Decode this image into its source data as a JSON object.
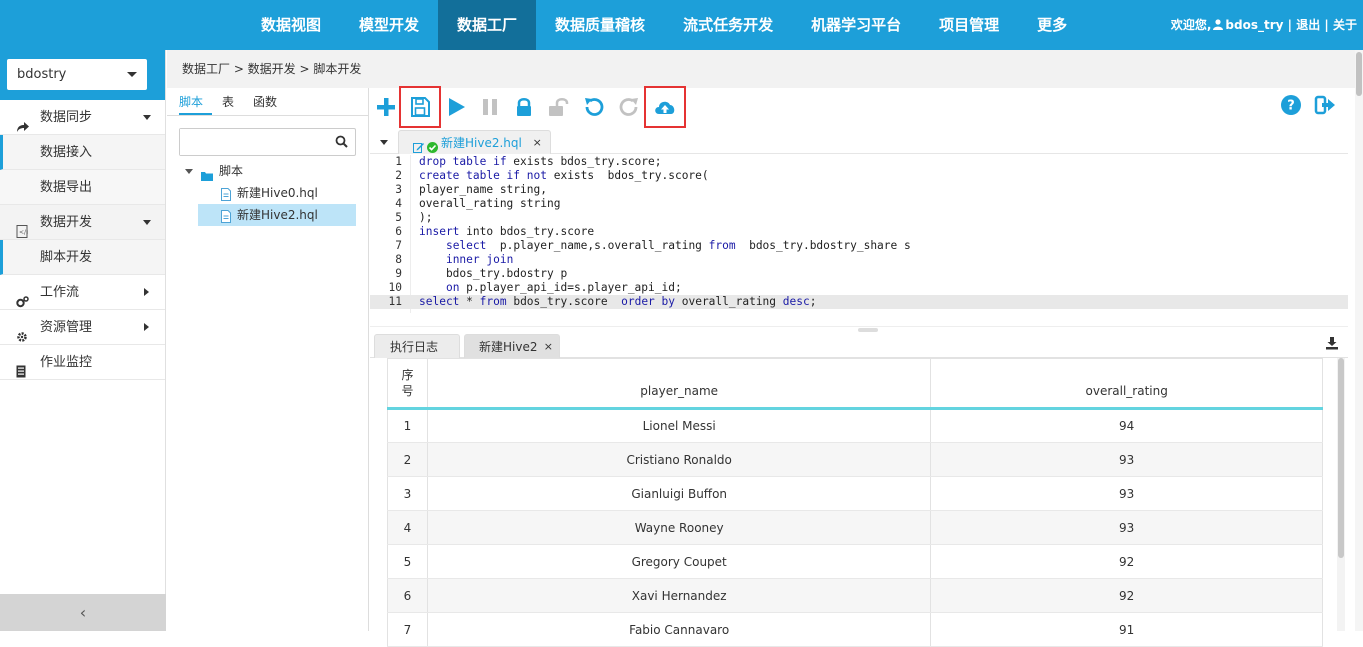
{
  "nav": {
    "items": [
      {
        "label": "数据视图",
        "active": false
      },
      {
        "label": "模型开发",
        "active": false
      },
      {
        "label": "数据工厂",
        "active": true
      },
      {
        "label": "数据质量稽核",
        "active": false
      },
      {
        "label": "流式任务开发",
        "active": false
      },
      {
        "label": "机器学习平台",
        "active": false
      },
      {
        "label": "项目管理",
        "active": false
      },
      {
        "label": "更多",
        "active": false
      }
    ],
    "welcome": "欢迎您,",
    "username": "bdos_try",
    "logout": "退出",
    "about": "关于",
    "sep": "|"
  },
  "sidebar": {
    "project": "bdostry",
    "menu": {
      "sync": {
        "label": "数据同步",
        "icon": "share-arrow-icon"
      },
      "sync_in": {
        "label": "数据接入"
      },
      "sync_out": {
        "label": "数据导出"
      },
      "dev": {
        "label": "数据开发",
        "icon": "code-file-icon"
      },
      "dev_script": {
        "label": "脚本开发"
      },
      "workflow": {
        "label": "工作流",
        "icon": "gears-icon"
      },
      "resource": {
        "label": "资源管理",
        "icon": "gear-icon"
      },
      "monitor": {
        "label": "作业监控",
        "icon": "server-icon"
      }
    },
    "collapse": "‹"
  },
  "breadcrumb": "数据工厂 > 数据开发 > 脚本开发",
  "filepanel": {
    "tabs": [
      "脚本",
      "表",
      "函数"
    ],
    "search_placeholder": "",
    "folder": "脚本",
    "files": [
      "新建Hive0.hql",
      "新建Hive2.hql"
    ]
  },
  "editor": {
    "tab_label": "新建Hive2.hql",
    "close": "×",
    "lines": [
      {
        "n": "1"
      },
      {
        "n": "2"
      },
      {
        "n": "3"
      },
      {
        "n": "4"
      },
      {
        "n": "5"
      },
      {
        "n": "6"
      },
      {
        "n": "7"
      },
      {
        "n": "8"
      },
      {
        "n": "9"
      },
      {
        "n": "10"
      },
      {
        "n": "11"
      }
    ]
  },
  "results": {
    "tabs": [
      "执行日志",
      "新建Hive2"
    ],
    "close": "×",
    "headers": {
      "idx": "序号",
      "name": "player_name",
      "rating": "overall_rating"
    },
    "rows": [
      {
        "idx": "1",
        "name": "Lionel Messi",
        "rating": "94"
      },
      {
        "idx": "2",
        "name": "Cristiano Ronaldo",
        "rating": "93"
      },
      {
        "idx": "3",
        "name": "Gianluigi Buffon",
        "rating": "93"
      },
      {
        "idx": "4",
        "name": "Wayne Rooney",
        "rating": "93"
      },
      {
        "idx": "5",
        "name": "Gregory Coupet",
        "rating": "92"
      },
      {
        "idx": "6",
        "name": "Xavi Hernandez",
        "rating": "92"
      },
      {
        "idx": "7",
        "name": "Fabio Cannavaro",
        "rating": "91"
      }
    ]
  },
  "colors": {
    "nav_bg": "#1d9fd9",
    "nav_active": "#126f9a",
    "accent": "#1d9fd9",
    "highlight": "#e53333",
    "keyword": "#1a1aa6"
  }
}
